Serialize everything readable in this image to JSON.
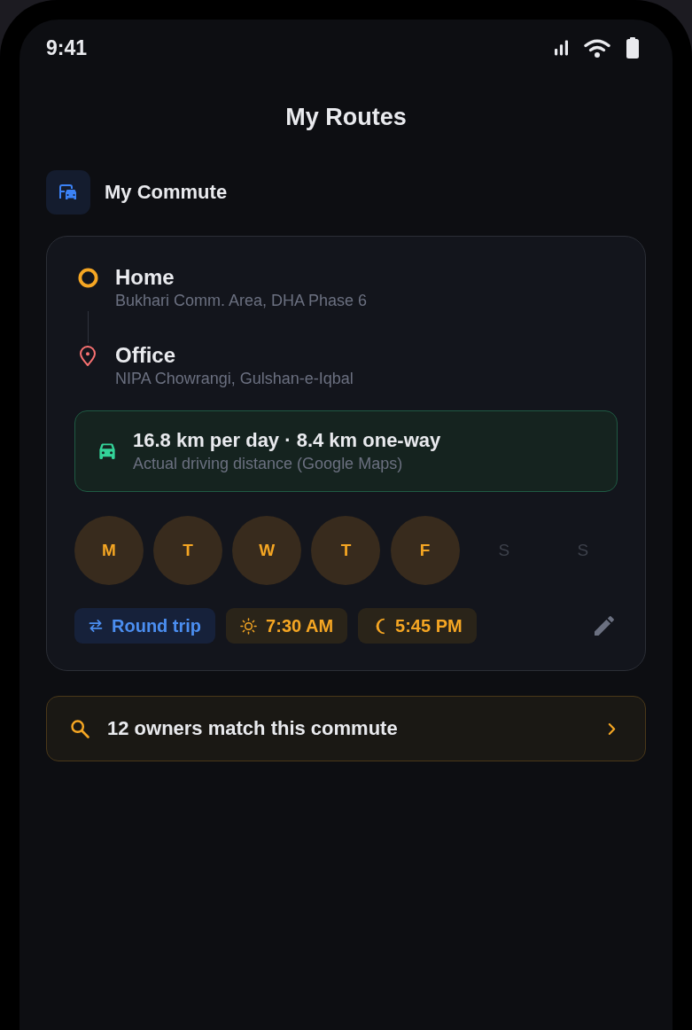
{
  "status_bar": {
    "time": "9:41"
  },
  "header": {
    "title": "My Routes"
  },
  "section": {
    "title": "My Commute"
  },
  "route_card": {
    "stops": [
      {
        "kind": "origin",
        "name": "Home",
        "address": "Bukhari Comm. Area, DHA Phase 6"
      },
      {
        "kind": "destination",
        "name": "Office",
        "address": "NIPA Chowrangi, Gulshan-e-Iqbal"
      }
    ],
    "distance": {
      "title": "16.8 km per day · 8.4 km one-way",
      "subtitle": "Actual driving distance (Google Maps)"
    },
    "days": [
      {
        "label": "M",
        "selected": true
      },
      {
        "label": "T",
        "selected": true
      },
      {
        "label": "W",
        "selected": true
      },
      {
        "label": "T",
        "selected": true
      },
      {
        "label": "F",
        "selected": true
      },
      {
        "label": "S",
        "selected": false
      },
      {
        "label": "S",
        "selected": false
      }
    ],
    "chips": [
      {
        "kind": "trip_type",
        "label": "Round trip"
      },
      {
        "kind": "departure",
        "label": "7:30 AM"
      },
      {
        "kind": "return",
        "label": "5:45 PM"
      }
    ]
  },
  "match_banner": {
    "text": "12 owners match this commute"
  }
}
